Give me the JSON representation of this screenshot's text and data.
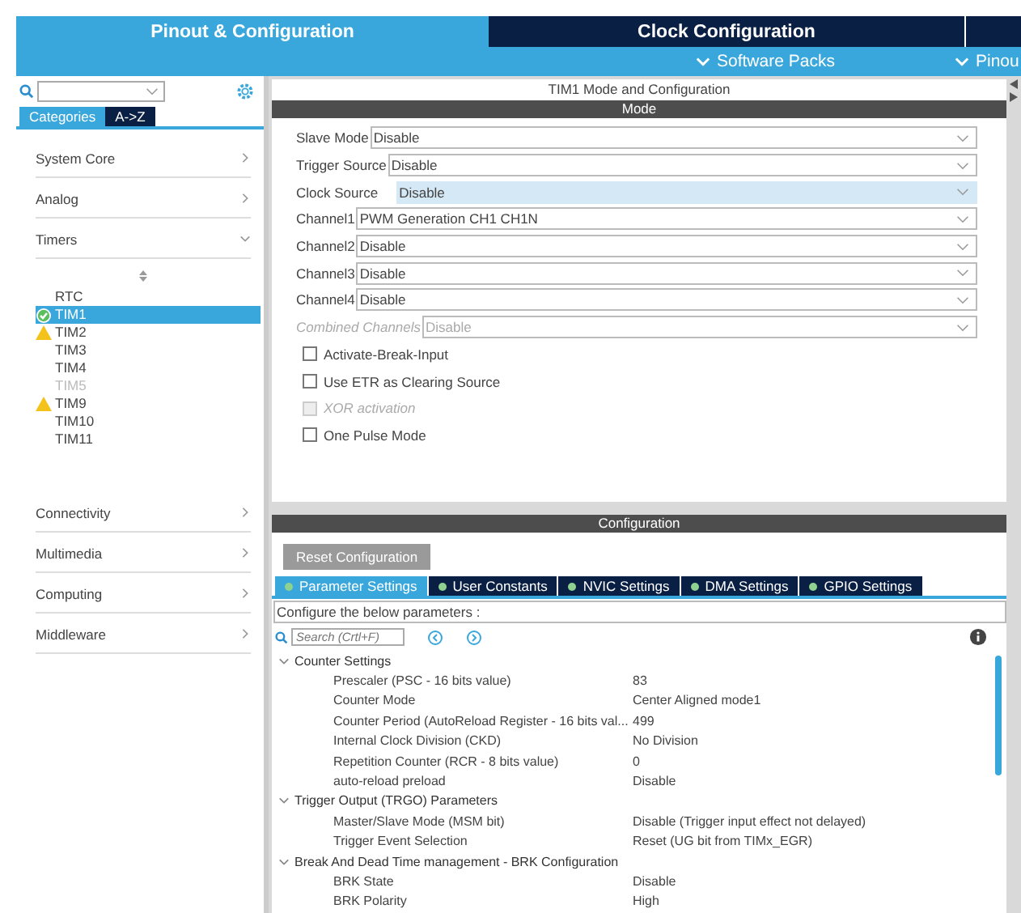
{
  "top_tabs": [
    {
      "label": "Pinout & Configuration",
      "selected": true
    },
    {
      "label": "Clock Configuration",
      "selected": false
    }
  ],
  "subbar": [
    "Software Packs",
    "Pinou"
  ],
  "sidebar": {
    "tabs": [
      {
        "label": "Categories",
        "selected": true
      },
      {
        "label": "A->Z",
        "selected": false
      }
    ],
    "categories": [
      {
        "label": "System Core",
        "expanded": false
      },
      {
        "label": "Analog",
        "expanded": false
      },
      {
        "label": "Timers",
        "expanded": true,
        "children": [
          {
            "label": "RTC",
            "kind": "plain",
            "selected": false,
            "disabled": false
          },
          {
            "label": "TIM1",
            "kind": "ok",
            "selected": true,
            "disabled": false
          },
          {
            "label": "TIM2",
            "kind": "warning",
            "selected": false,
            "disabled": false
          },
          {
            "label": "TIM3",
            "kind": "plain",
            "selected": false,
            "disabled": false
          },
          {
            "label": "TIM4",
            "kind": "plain",
            "selected": false,
            "disabled": false
          },
          {
            "label": "TIM5",
            "kind": "plain",
            "selected": false,
            "disabled": true
          },
          {
            "label": "TIM9",
            "kind": "warning",
            "selected": false,
            "disabled": false
          },
          {
            "label": "TIM10",
            "kind": "plain",
            "selected": false,
            "disabled": false
          },
          {
            "label": "TIM11",
            "kind": "plain",
            "selected": false,
            "disabled": false
          }
        ]
      },
      {
        "label": "Connectivity",
        "expanded": false
      },
      {
        "label": "Multimedia",
        "expanded": false
      },
      {
        "label": "Computing",
        "expanded": false
      },
      {
        "label": "Middleware",
        "expanded": false
      }
    ]
  },
  "mode": {
    "title": "TIM1 Mode and Configuration",
    "header": "Mode",
    "fields": [
      {
        "label": "Slave Mode",
        "value": "Disable",
        "highlighted": false,
        "disabled": false
      },
      {
        "label": "Trigger Source",
        "value": "Disable",
        "highlighted": false,
        "disabled": false
      },
      {
        "label": "Clock Source",
        "value": "Disable",
        "highlighted": true,
        "disabled": false
      },
      {
        "label": "Channel1",
        "value": "PWM Generation CH1 CH1N",
        "highlighted": false,
        "disabled": false
      },
      {
        "label": "Channel2",
        "value": "Disable",
        "highlighted": false,
        "disabled": false
      },
      {
        "label": "Channel3",
        "value": "Disable",
        "highlighted": false,
        "disabled": false
      },
      {
        "label": "Channel4",
        "value": "Disable",
        "highlighted": false,
        "disabled": false
      },
      {
        "label": "Combined Channels",
        "value": "Disable",
        "highlighted": false,
        "disabled": true
      }
    ],
    "checkboxes": [
      {
        "label": "Activate-Break-Input",
        "checked": false,
        "disabled": false
      },
      {
        "label": "Use ETR as Clearing Source",
        "checked": false,
        "disabled": false
      },
      {
        "label": "XOR activation",
        "checked": false,
        "disabled": true
      },
      {
        "label": "One Pulse Mode",
        "checked": false,
        "disabled": false
      }
    ]
  },
  "config": {
    "header": "Configuration",
    "reset_button": "Reset Configuration",
    "tabs": [
      {
        "label": "Parameter Settings",
        "selected": true
      },
      {
        "label": "User Constants",
        "selected": false
      },
      {
        "label": "NVIC Settings",
        "selected": false
      },
      {
        "label": "DMA Settings",
        "selected": false
      },
      {
        "label": "GPIO Settings",
        "selected": false
      }
    ],
    "hint": "Configure the below parameters :",
    "search": {
      "placeholder": "Search (Crtl+F)"
    },
    "groups": [
      {
        "label": "Counter Settings",
        "expanded": true,
        "params": [
          {
            "name": "Prescaler (PSC - 16 bits value)",
            "value": "83"
          },
          {
            "name": "Counter Mode",
            "value": "Center Aligned mode1"
          },
          {
            "name": "Counter Period (AutoReload Register - 16 bits val...",
            "value": "499"
          },
          {
            "name": "Internal Clock Division (CKD)",
            "value": "No Division"
          },
          {
            "name": "Repetition Counter (RCR - 8 bits value)",
            "value": "0"
          },
          {
            "name": "auto-reload preload",
            "value": "Disable"
          }
        ]
      },
      {
        "label": "Trigger Output (TRGO) Parameters",
        "expanded": true,
        "params": [
          {
            "name": "Master/Slave Mode (MSM bit)",
            "value": "Disable (Trigger input effect not delayed)"
          },
          {
            "name": "Trigger Event Selection",
            "value": "Reset (UG bit from TIMx_EGR)"
          }
        ]
      },
      {
        "label": "Break And Dead Time management - BRK Configuration",
        "expanded": true,
        "params": [
          {
            "name": "BRK State",
            "value": "Disable"
          },
          {
            "name": "BRK Polarity",
            "value": "High"
          }
        ]
      }
    ]
  }
}
